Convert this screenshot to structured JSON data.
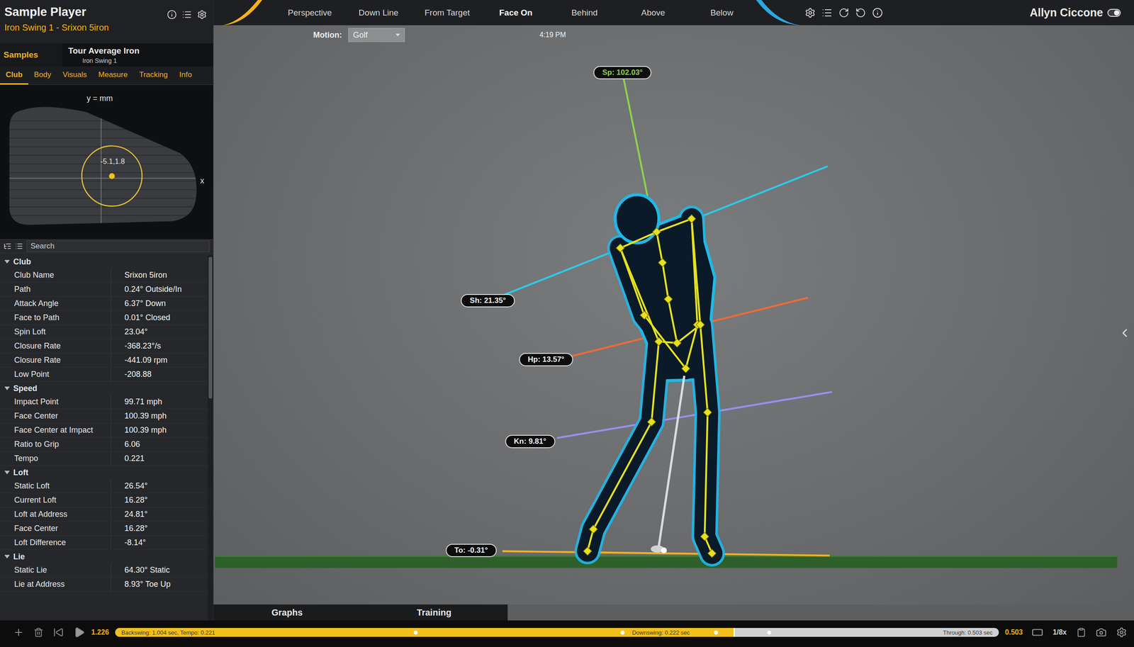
{
  "window": {
    "title": "Sample Player",
    "subtitle": "Iron Swing 1 - Srixon 5iron",
    "user": "Allyn Ciccone",
    "user_toggle_on": true
  },
  "view_tabs": [
    {
      "label": "Perspective",
      "selected": false
    },
    {
      "label": "Down Line",
      "selected": false
    },
    {
      "label": "From Target",
      "selected": false
    },
    {
      "label": "Face On",
      "selected": true
    },
    {
      "label": "Behind",
      "selected": false
    },
    {
      "label": "Above",
      "selected": false
    },
    {
      "label": "Below",
      "selected": false
    }
  ],
  "motion": {
    "label": "Motion:",
    "value": "Golf"
  },
  "clock": "4:19 PM",
  "samples": {
    "label": "Samples",
    "name": "Tour Average Iron",
    "swing": "Iron Swing 1"
  },
  "panel_tabs": [
    {
      "label": "Club",
      "selected": true
    },
    {
      "label": "Body",
      "selected": false
    },
    {
      "label": "Visuals",
      "selected": false
    },
    {
      "label": "Measure",
      "selected": false
    },
    {
      "label": "Tracking",
      "selected": false
    },
    {
      "label": "Info",
      "selected": false
    }
  ],
  "face_diagram": {
    "axis_y": "y = mm",
    "axis_x": "x",
    "impact": "-5.1,1.8"
  },
  "search": {
    "placeholder": "Search"
  },
  "tree": [
    {
      "section": "Club",
      "expanded": true,
      "rows": [
        {
          "label": "Club Name",
          "value": "Srixon 5iron"
        },
        {
          "label": "Path",
          "value": "0.24° Outside/In"
        },
        {
          "label": "Attack Angle",
          "value": "6.37° Down"
        },
        {
          "label": "Face to Path",
          "value": "0.01° Closed"
        },
        {
          "label": "Spin Loft",
          "value": "23.04°"
        },
        {
          "label": "Closure Rate",
          "value": "-368.23°/s"
        },
        {
          "label": "Closure Rate",
          "value": "-441.09 rpm"
        },
        {
          "label": "Low Point",
          "value": "-208.88"
        }
      ]
    },
    {
      "section": "Speed",
      "expanded": true,
      "rows": [
        {
          "label": "Impact Point",
          "value": "99.71 mph"
        },
        {
          "label": "Face Center",
          "value": "100.39 mph"
        },
        {
          "label": "Face Center at Impact",
          "value": "100.39 mph"
        },
        {
          "label": "Ratio to Grip",
          "value": "6.06"
        },
        {
          "label": "Tempo",
          "value": "0.221"
        }
      ]
    },
    {
      "section": "Loft",
      "expanded": true,
      "rows": [
        {
          "label": "Static Loft",
          "value": "26.54°"
        },
        {
          "label": "Current Loft",
          "value": "16.28°"
        },
        {
          "label": "Loft at Address",
          "value": "24.81°"
        },
        {
          "label": "Face Center",
          "value": "16.28°"
        },
        {
          "label": "Loft Difference",
          "value": "-8.14°"
        }
      ]
    },
    {
      "section": "Lie",
      "expanded": true,
      "rows": [
        {
          "label": "Static Lie",
          "value": "64.30° Static"
        },
        {
          "label": "Lie at Address",
          "value": "8.93° Toe Up"
        }
      ]
    }
  ],
  "angles": [
    {
      "label": "Sp: 102.03°",
      "color": "#8fd14f"
    },
    {
      "label": "Sh: 21.35°",
      "color": "#2ec9e8"
    },
    {
      "label": "Hp: 13.57°",
      "color": "#f06a3a"
    },
    {
      "label": "Kn: 9.81°",
      "color": "#9a8ff0"
    },
    {
      "label": "To: -0.31°",
      "color": "#f2b21b"
    }
  ],
  "bottom_tabs": [
    {
      "label": "Graphs",
      "selected": false
    },
    {
      "label": "Training",
      "selected": false
    }
  ],
  "timeline": {
    "time": "1.226",
    "backswing": "Backswing: 1.004 sec, Tempo: 0.221",
    "downswing": "Downswing: 0.222 sec",
    "through": "Through: 0.503 sec",
    "level": 0.7,
    "through_time": "0.503",
    "speed": "1/8x"
  }
}
